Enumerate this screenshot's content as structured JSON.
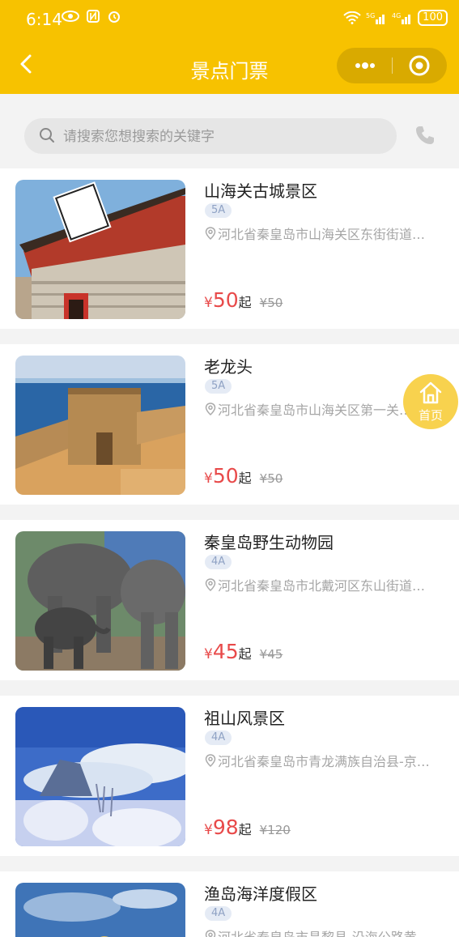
{
  "status_bar": {
    "time": "6:14",
    "battery": "100",
    "signal": "5G 4G"
  },
  "nav": {
    "title": "景点门票"
  },
  "search": {
    "placeholder": "请搜索您想搜索的关键字"
  },
  "home_button": {
    "label": "首页"
  },
  "colors": {
    "brand": "#f7c200",
    "price": "#e84a4a",
    "badge_bg": "#e5ebf5"
  },
  "items": [
    {
      "name": "山海关古城景区",
      "level": "5A",
      "address": "河北省秦皇岛市山海关区东街街道…",
      "currency": "¥",
      "price": "50",
      "suffix": "起",
      "original": "¥50"
    },
    {
      "name": "老龙头",
      "level": "5A",
      "address": "河北省秦皇岛市山海关区第一关…",
      "currency": "¥",
      "price": "50",
      "suffix": "起",
      "original": "¥50"
    },
    {
      "name": "秦皇岛野生动物园",
      "level": "4A",
      "address": "河北省秦皇岛市北戴河区东山街道…",
      "currency": "¥",
      "price": "45",
      "suffix": "起",
      "original": "¥45"
    },
    {
      "name": "祖山风景区",
      "level": "4A",
      "address": "河北省秦皇岛市青龙满族自治县-京…",
      "currency": "¥",
      "price": "98",
      "suffix": "起",
      "original": "¥120"
    },
    {
      "name": "渔岛海洋度假区",
      "level": "4A",
      "address": "河北省秦皇岛市昌黎县-沿海公路黄…",
      "currency": "¥",
      "price": "",
      "suffix": "",
      "original": ""
    }
  ]
}
